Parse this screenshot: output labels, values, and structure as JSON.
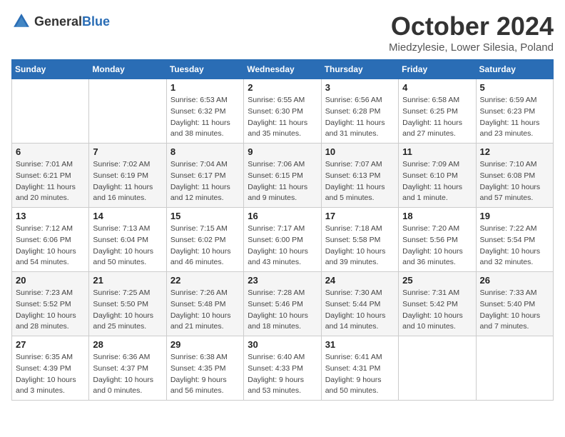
{
  "logo": {
    "general": "General",
    "blue": "Blue"
  },
  "title": "October 2024",
  "location": "Miedzylesie, Lower Silesia, Poland",
  "weekdays": [
    "Sunday",
    "Monday",
    "Tuesday",
    "Wednesday",
    "Thursday",
    "Friday",
    "Saturday"
  ],
  "weeks": [
    [
      {
        "num": "",
        "sunrise": "",
        "sunset": "",
        "daylight": ""
      },
      {
        "num": "",
        "sunrise": "",
        "sunset": "",
        "daylight": ""
      },
      {
        "num": "1",
        "sunrise": "Sunrise: 6:53 AM",
        "sunset": "Sunset: 6:32 PM",
        "daylight": "Daylight: 11 hours and 38 minutes."
      },
      {
        "num": "2",
        "sunrise": "Sunrise: 6:55 AM",
        "sunset": "Sunset: 6:30 PM",
        "daylight": "Daylight: 11 hours and 35 minutes."
      },
      {
        "num": "3",
        "sunrise": "Sunrise: 6:56 AM",
        "sunset": "Sunset: 6:28 PM",
        "daylight": "Daylight: 11 hours and 31 minutes."
      },
      {
        "num": "4",
        "sunrise": "Sunrise: 6:58 AM",
        "sunset": "Sunset: 6:25 PM",
        "daylight": "Daylight: 11 hours and 27 minutes."
      },
      {
        "num": "5",
        "sunrise": "Sunrise: 6:59 AM",
        "sunset": "Sunset: 6:23 PM",
        "daylight": "Daylight: 11 hours and 23 minutes."
      }
    ],
    [
      {
        "num": "6",
        "sunrise": "Sunrise: 7:01 AM",
        "sunset": "Sunset: 6:21 PM",
        "daylight": "Daylight: 11 hours and 20 minutes."
      },
      {
        "num": "7",
        "sunrise": "Sunrise: 7:02 AM",
        "sunset": "Sunset: 6:19 PM",
        "daylight": "Daylight: 11 hours and 16 minutes."
      },
      {
        "num": "8",
        "sunrise": "Sunrise: 7:04 AM",
        "sunset": "Sunset: 6:17 PM",
        "daylight": "Daylight: 11 hours and 12 minutes."
      },
      {
        "num": "9",
        "sunrise": "Sunrise: 7:06 AM",
        "sunset": "Sunset: 6:15 PM",
        "daylight": "Daylight: 11 hours and 9 minutes."
      },
      {
        "num": "10",
        "sunrise": "Sunrise: 7:07 AM",
        "sunset": "Sunset: 6:13 PM",
        "daylight": "Daylight: 11 hours and 5 minutes."
      },
      {
        "num": "11",
        "sunrise": "Sunrise: 7:09 AM",
        "sunset": "Sunset: 6:10 PM",
        "daylight": "Daylight: 11 hours and 1 minute."
      },
      {
        "num": "12",
        "sunrise": "Sunrise: 7:10 AM",
        "sunset": "Sunset: 6:08 PM",
        "daylight": "Daylight: 10 hours and 57 minutes."
      }
    ],
    [
      {
        "num": "13",
        "sunrise": "Sunrise: 7:12 AM",
        "sunset": "Sunset: 6:06 PM",
        "daylight": "Daylight: 10 hours and 54 minutes."
      },
      {
        "num": "14",
        "sunrise": "Sunrise: 7:13 AM",
        "sunset": "Sunset: 6:04 PM",
        "daylight": "Daylight: 10 hours and 50 minutes."
      },
      {
        "num": "15",
        "sunrise": "Sunrise: 7:15 AM",
        "sunset": "Sunset: 6:02 PM",
        "daylight": "Daylight: 10 hours and 46 minutes."
      },
      {
        "num": "16",
        "sunrise": "Sunrise: 7:17 AM",
        "sunset": "Sunset: 6:00 PM",
        "daylight": "Daylight: 10 hours and 43 minutes."
      },
      {
        "num": "17",
        "sunrise": "Sunrise: 7:18 AM",
        "sunset": "Sunset: 5:58 PM",
        "daylight": "Daylight: 10 hours and 39 minutes."
      },
      {
        "num": "18",
        "sunrise": "Sunrise: 7:20 AM",
        "sunset": "Sunset: 5:56 PM",
        "daylight": "Daylight: 10 hours and 36 minutes."
      },
      {
        "num": "19",
        "sunrise": "Sunrise: 7:22 AM",
        "sunset": "Sunset: 5:54 PM",
        "daylight": "Daylight: 10 hours and 32 minutes."
      }
    ],
    [
      {
        "num": "20",
        "sunrise": "Sunrise: 7:23 AM",
        "sunset": "Sunset: 5:52 PM",
        "daylight": "Daylight: 10 hours and 28 minutes."
      },
      {
        "num": "21",
        "sunrise": "Sunrise: 7:25 AM",
        "sunset": "Sunset: 5:50 PM",
        "daylight": "Daylight: 10 hours and 25 minutes."
      },
      {
        "num": "22",
        "sunrise": "Sunrise: 7:26 AM",
        "sunset": "Sunset: 5:48 PM",
        "daylight": "Daylight: 10 hours and 21 minutes."
      },
      {
        "num": "23",
        "sunrise": "Sunrise: 7:28 AM",
        "sunset": "Sunset: 5:46 PM",
        "daylight": "Daylight: 10 hours and 18 minutes."
      },
      {
        "num": "24",
        "sunrise": "Sunrise: 7:30 AM",
        "sunset": "Sunset: 5:44 PM",
        "daylight": "Daylight: 10 hours and 14 minutes."
      },
      {
        "num": "25",
        "sunrise": "Sunrise: 7:31 AM",
        "sunset": "Sunset: 5:42 PM",
        "daylight": "Daylight: 10 hours and 10 minutes."
      },
      {
        "num": "26",
        "sunrise": "Sunrise: 7:33 AM",
        "sunset": "Sunset: 5:40 PM",
        "daylight": "Daylight: 10 hours and 7 minutes."
      }
    ],
    [
      {
        "num": "27",
        "sunrise": "Sunrise: 6:35 AM",
        "sunset": "Sunset: 4:39 PM",
        "daylight": "Daylight: 10 hours and 3 minutes."
      },
      {
        "num": "28",
        "sunrise": "Sunrise: 6:36 AM",
        "sunset": "Sunset: 4:37 PM",
        "daylight": "Daylight: 10 hours and 0 minutes."
      },
      {
        "num": "29",
        "sunrise": "Sunrise: 6:38 AM",
        "sunset": "Sunset: 4:35 PM",
        "daylight": "Daylight: 9 hours and 56 minutes."
      },
      {
        "num": "30",
        "sunrise": "Sunrise: 6:40 AM",
        "sunset": "Sunset: 4:33 PM",
        "daylight": "Daylight: 9 hours and 53 minutes."
      },
      {
        "num": "31",
        "sunrise": "Sunrise: 6:41 AM",
        "sunset": "Sunset: 4:31 PM",
        "daylight": "Daylight: 9 hours and 50 minutes."
      },
      {
        "num": "",
        "sunrise": "",
        "sunset": "",
        "daylight": ""
      },
      {
        "num": "",
        "sunrise": "",
        "sunset": "",
        "daylight": ""
      }
    ]
  ]
}
